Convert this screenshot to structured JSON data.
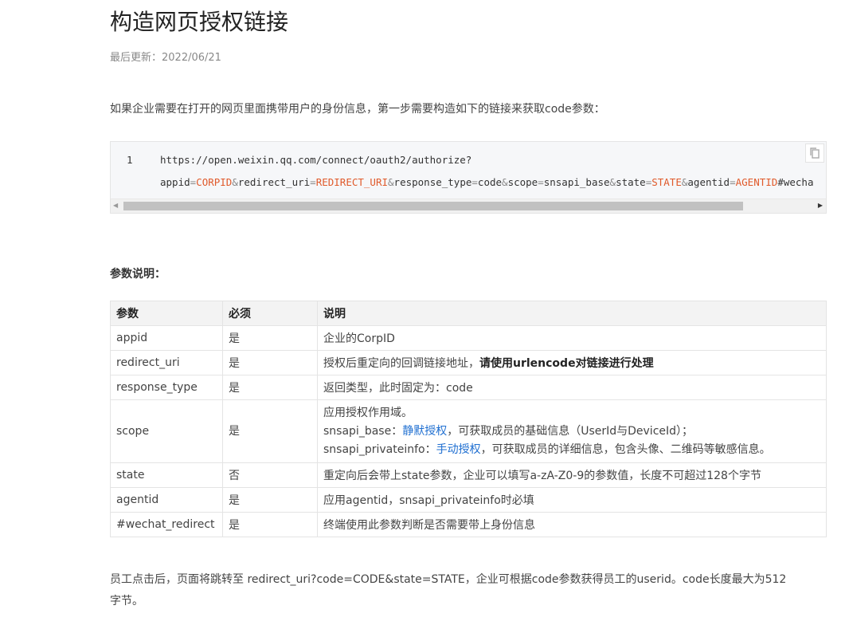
{
  "page": {
    "title": "构造网页授权链接",
    "last_updated_label": "最后更新：",
    "last_updated_date": "2022/06/21",
    "intro": "如果企业需要在打开的网页里面携带用户的身份信息，第一步需要构造如下的链接来获取code参数："
  },
  "code_block": {
    "line_number": "1",
    "line1": "https://open.weixin.qq.com/connect/oauth2/authorize?",
    "line2_parts": {
      "k1": "appid",
      "v1": "CORPID",
      "k2": "redirect_uri",
      "v2": "REDIRECT_URI",
      "k3": "response_type",
      "v3": "code",
      "k4": "scope",
      "v4": "snsapi_base",
      "k5": "state",
      "v5": "STATE",
      "k6": "agentid",
      "v6": "AGENTID",
      "tail": "#wecha"
    },
    "copy_icon": "copy-icon"
  },
  "params": {
    "heading": "参数说明：",
    "headers": {
      "name": "参数",
      "required": "必须",
      "desc": "说明"
    },
    "rows": {
      "appid": {
        "name": "appid",
        "required": "是",
        "desc": "企业的CorpID"
      },
      "redirect_uri": {
        "name": "redirect_uri",
        "required": "是",
        "desc_plain": "授权后重定向的回调链接地址，",
        "desc_bold": "请使用urlencode对链接进行处理"
      },
      "response_type": {
        "name": "response_type",
        "required": "是",
        "desc": "返回类型，此时固定为：code"
      },
      "scope": {
        "name": "scope",
        "required": "是",
        "line1": "应用授权作用域。",
        "line2_pre": "snsapi_base：",
        "line2_link": "静默授权",
        "line2_post": "，可获取成员的基础信息（UserId与DeviceId）；",
        "line3_pre": "snsapi_privateinfo：",
        "line3_link": "手动授权",
        "line3_post": "，可获取成员的详细信息，包含头像、二维码等敏感信息。"
      },
      "state": {
        "name": "state",
        "required": "否",
        "desc": "重定向后会带上state参数，企业可以填写a-zA-Z0-9的参数值，长度不可超过128个字节"
      },
      "agentid": {
        "name": "agentid",
        "required": "是",
        "desc": "应用agentid，snsapi_privateinfo时必填"
      },
      "wechat_redirect": {
        "name": "#wechat_redirect",
        "required": "是",
        "desc": "终端使用此参数判断是否需要带上身份信息"
      }
    }
  },
  "outro": {
    "line1": "员工点击后，页面将跳转至 redirect_uri?code=CODE&state=STATE，企业可根据code参数获得员工的userid。code长度最大为512",
    "line2": "字节。"
  },
  "colors": {
    "link": "#1f6fd1",
    "code_value": "#e05a2b"
  }
}
